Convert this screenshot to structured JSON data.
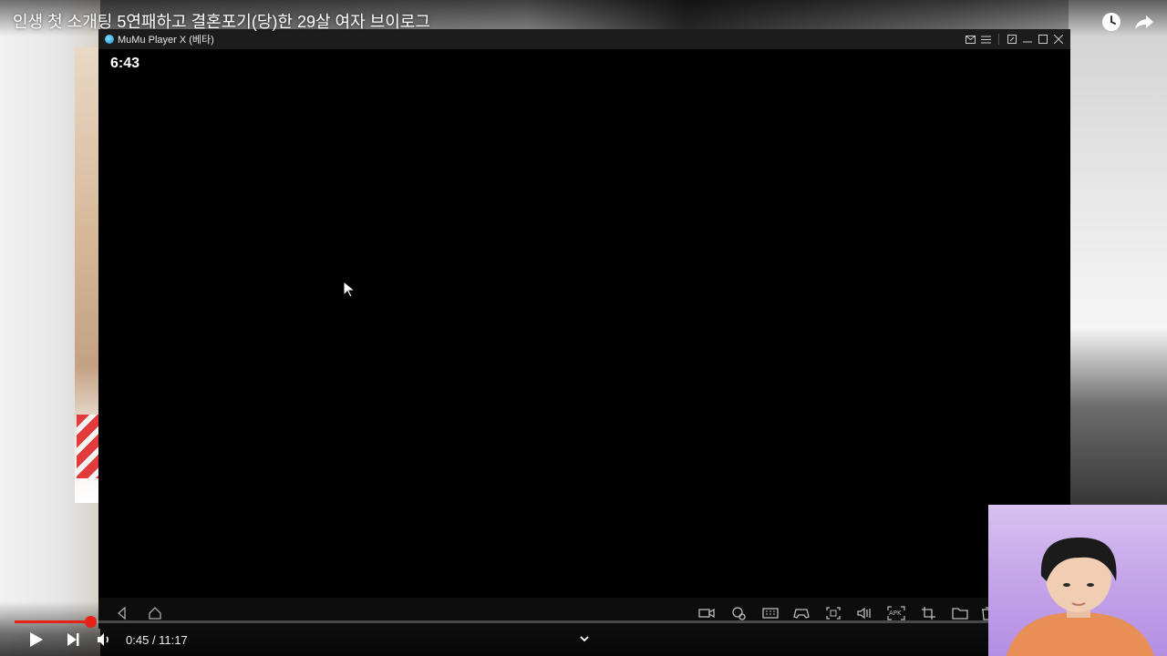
{
  "video": {
    "title": "인생 첫 소개팅 5연패하고 결혼포기(당)한 29살 여자 브이로그",
    "current_time": "0:45",
    "duration": "11:17",
    "progress_fraction": 0.0665,
    "accent_color": "#e62117"
  },
  "emulator": {
    "window_title": "MuMu Player X (베타)",
    "clock": "6:43",
    "title_icons": [
      "mail-icon",
      "menu-icon",
      "pin-icon",
      "minimize-icon",
      "maximize-icon",
      "close-icon"
    ],
    "nav_icons": [
      "back-icon",
      "home-icon"
    ],
    "toolbar_icons": [
      "record-icon",
      "location-icon",
      "keyboard-icon",
      "gamepad-icon",
      "screenshot-icon",
      "volume-icon",
      "apk-icon",
      "crop-icon",
      "folder-icon",
      "trash-icon"
    ],
    "apk_label": "APK"
  }
}
